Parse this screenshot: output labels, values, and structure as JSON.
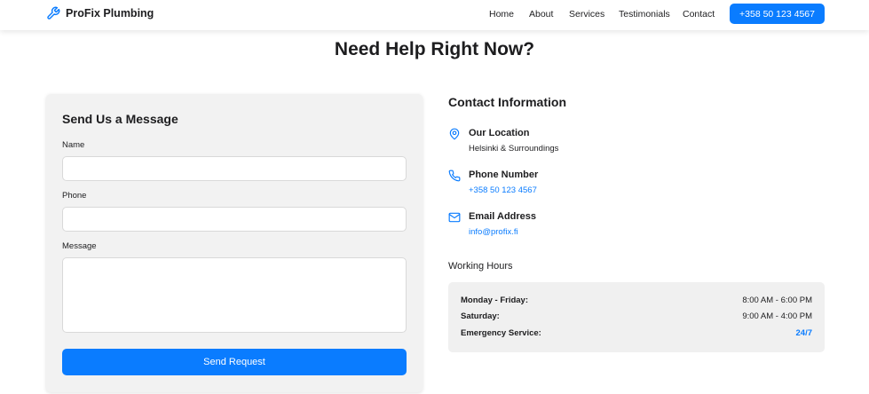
{
  "header": {
    "brand": "ProFix Plumbing",
    "brand_icon": "wrench-icon",
    "nav": [
      "Home",
      "About",
      "Services",
      "Testimonials",
      "Contact"
    ],
    "cta": "+358 50 123 4567"
  },
  "headline": "Need Help Right Now?",
  "form": {
    "title": "Send Us a Message",
    "name_label": "Name",
    "name_value": "",
    "phone_label": "Phone",
    "phone_value": "",
    "message_label": "Message",
    "message_value": "",
    "submit": "Send Request"
  },
  "contact": {
    "title": "Contact Information",
    "items": [
      {
        "icon": "map-pin-icon",
        "heading": "Our Location",
        "value": "Helsinki & Surroundings"
      },
      {
        "icon": "phone-icon",
        "heading": "Phone Number",
        "value": "+358 50 123 4567"
      },
      {
        "icon": "mail-icon",
        "heading": "Email Address",
        "value": "info@profix.fi"
      }
    ]
  },
  "hours": {
    "title": "Working Hours",
    "rows": [
      {
        "day": "Monday - Friday:",
        "time": "8:00 AM - 6:00 PM"
      },
      {
        "day": "Saturday:",
        "time": "9:00 AM - 4:00 PM"
      },
      {
        "day": "Emergency Service:",
        "time": "24/7"
      }
    ]
  },
  "colors": {
    "accent": "#0a7cff",
    "card_bg": "#f2f2f2",
    "text": "#1d1d1f"
  }
}
